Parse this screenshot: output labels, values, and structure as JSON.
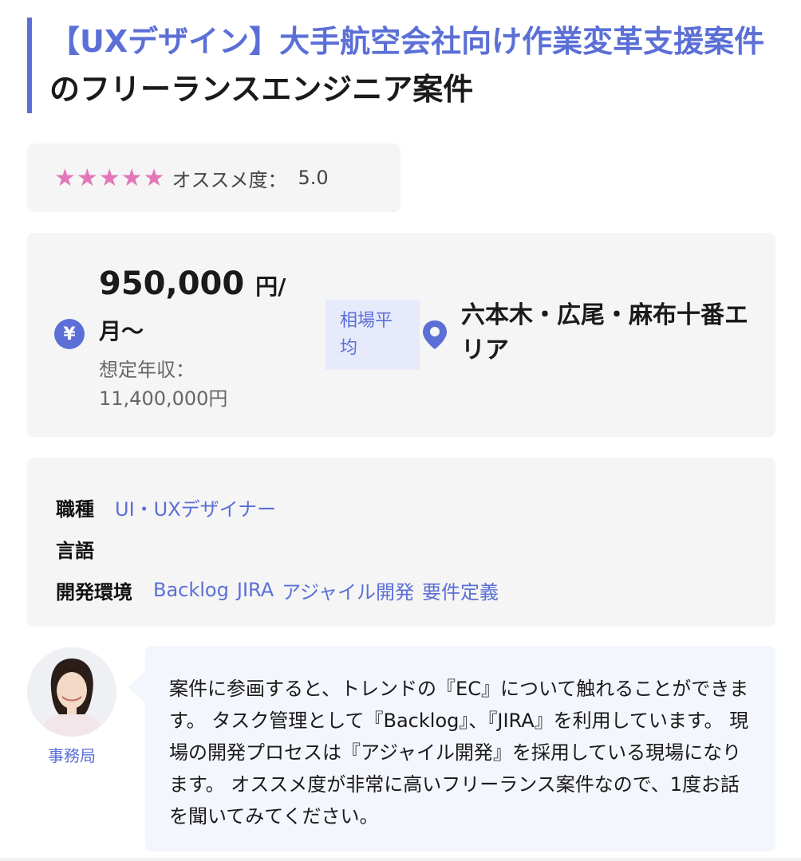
{
  "title": {
    "highlight": "【UXデザイン】大手航空会社向け作業変革支援案件",
    "suffix": "のフリーランスエンジニア案件"
  },
  "rating": {
    "stars": "★★★★★",
    "score": 5.0,
    "label": "オススメ度：",
    "value": "5.0",
    "star_color": "#e177b8"
  },
  "price": {
    "icon": "yen-icon",
    "amount": "950,000",
    "unit": "円/月〜",
    "annual_label": "想定年収：",
    "annual_value": "11,400,000円"
  },
  "badge": {
    "label": "相場平均"
  },
  "location": {
    "icon": "map-pin-icon",
    "text": "六本木・広尾・麻布十番エリア"
  },
  "details": {
    "job_type_label": "職種",
    "job_type_value": "UI・UXデザイナー",
    "language_label": "言語",
    "language_value": "",
    "env_label": "開発環境",
    "env_tags": [
      "Backlog",
      "JIRA",
      "アジャイル開発",
      "要件定義"
    ]
  },
  "comment": {
    "avatar_label": "事務局",
    "text": "案件に参画すると、トレンドの『EC』について触れることができます。 タスク管理として『Backlog』、『JIRA』を利用しています。 現場の開発プロセスは『アジャイル開発』を採用している現場になります。 オススメ度が非常に高いフリーランス案件なので、1度お話を聞いてみてください。"
  },
  "colors": {
    "accent": "#5b6fd6",
    "card_bg": "#f5f5f5",
    "badge_bg": "#e6eafb"
  }
}
